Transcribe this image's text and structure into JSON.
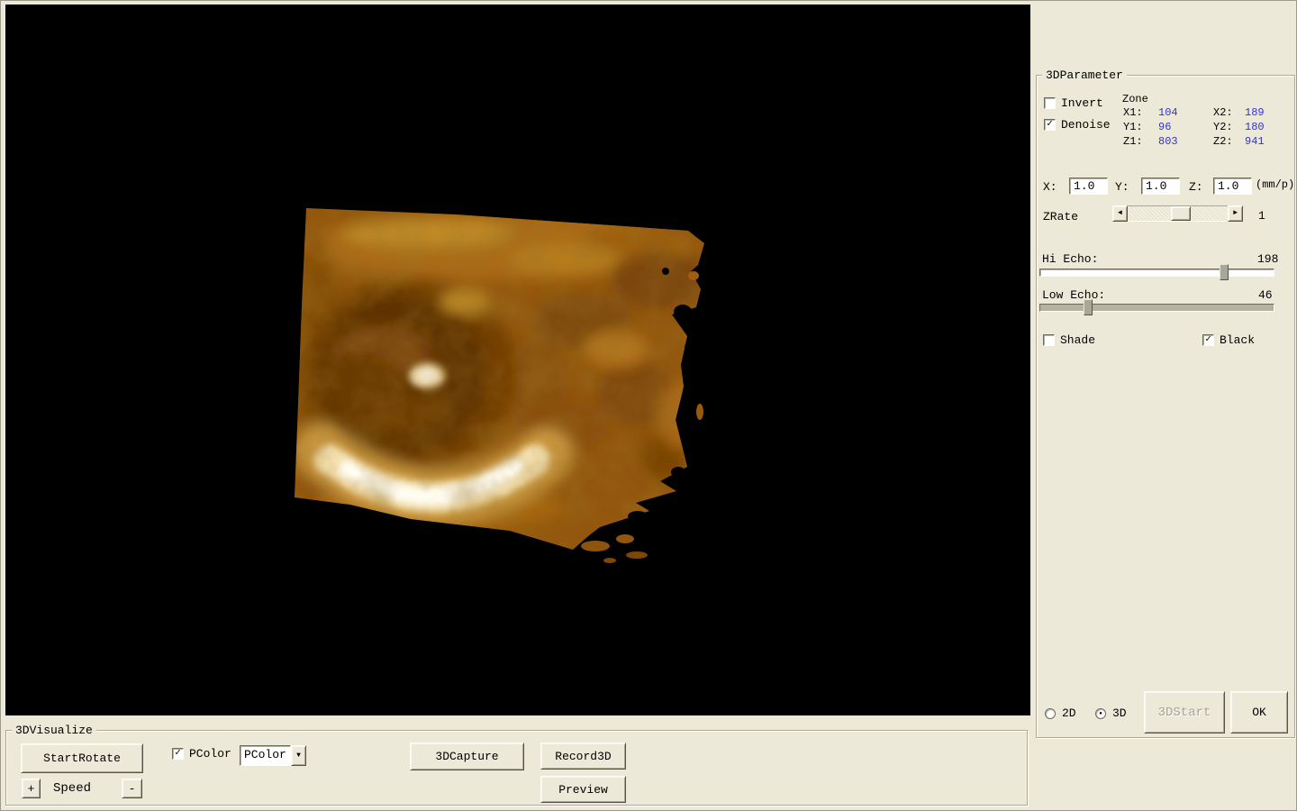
{
  "colors": {
    "bg": "#ece9d8",
    "viewport_bg": "#000000",
    "value_blue": "#3333cc",
    "volume_base": "#93560d"
  },
  "icons": {
    "dropdown_arrow": "▼",
    "scroll_left": "◄",
    "scroll_right": "►"
  },
  "right_panel": {
    "group_title": "3DParameter",
    "invert_label": "Invert",
    "denoise_label": "Denoise",
    "checks": {
      "invert": "",
      "denoise": "✓",
      "shade": "",
      "black": "✓",
      "pcolor": "✓"
    },
    "zone": {
      "title": "Zone",
      "x1_label": "X1:",
      "x1_value": "104",
      "x2_label": "X2:",
      "x2_value": "189",
      "y1_label": "Y1:",
      "y1_value": "96",
      "y2_label": "Y2:",
      "y2_value": "180",
      "z1_label": "Z1:",
      "z1_value": "803",
      "z2_label": "Z2:",
      "z2_value": "941"
    },
    "scale": {
      "x_label": "X:",
      "x_value": "1.0",
      "y_label": "Y:",
      "y_value": "1.0",
      "z_label": "Z:",
      "z_value": "1.0",
      "unit": "(mm/p)"
    },
    "zrate": {
      "label": "ZRate",
      "value": "1"
    },
    "hi_echo": {
      "label": "Hi Echo:",
      "value": "198"
    },
    "low_echo": {
      "label": "Low Echo:",
      "value": "46"
    },
    "shade_label": "Shade",
    "black_label": "Black",
    "radio_2d_label": "2D",
    "radio_3d_label": "3D",
    "radios": {
      "d2": "",
      "d3": "●"
    },
    "start3d_button": "3DStart",
    "ok_button": "OK"
  },
  "bottom_panel": {
    "group_title": "3DVisualize",
    "start_rotate_button": "StartRotate",
    "pcolor_label": "PColor",
    "pcolor_selected": "PColor",
    "capture_button": "3DCapture",
    "record_button": "Record3D",
    "preview_button": "Preview",
    "speed_plus": "+",
    "speed_label": "Speed",
    "speed_minus": "-"
  }
}
